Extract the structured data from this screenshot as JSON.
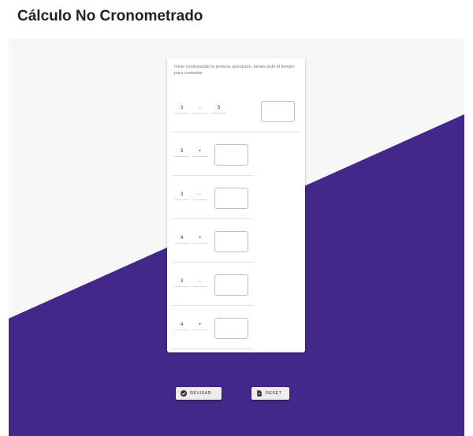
{
  "page": {
    "title": "Cálculo No Cronometrado"
  },
  "card": {
    "instruction": "Inicie contestando la primera operación, tienes todo el tiempo para contestar."
  },
  "operations": [
    {
      "a": "3",
      "op": "-",
      "b": "5"
    },
    {
      "a": "3",
      "op": "+",
      "b": ""
    },
    {
      "a": "3",
      "op": "-",
      "b": ""
    },
    {
      "a": "4",
      "op": "+",
      "b": ""
    },
    {
      "a": "3",
      "op": "-",
      "b": ""
    },
    {
      "a": "4",
      "op": "+",
      "b": ""
    }
  ],
  "buttons": {
    "review_label": "REVISAR",
    "review_icon": "check-circle-icon",
    "reset_label": "RESET",
    "reset_icon": "document-icon"
  },
  "colors": {
    "accent": "#43288a",
    "background": "#f7f7f7"
  }
}
